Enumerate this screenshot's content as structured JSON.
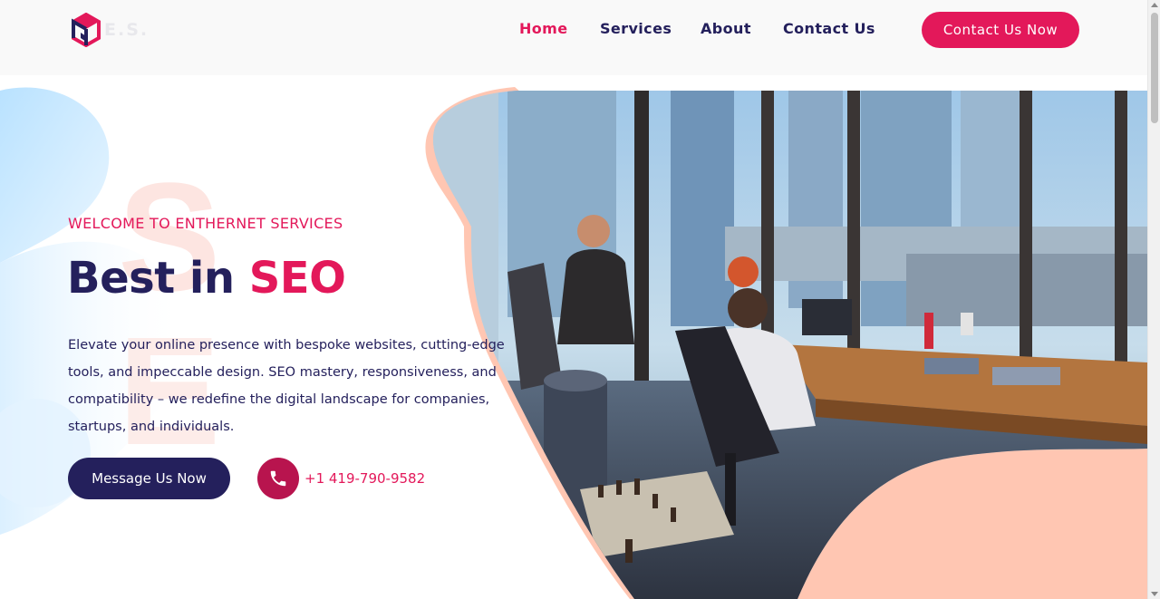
{
  "header": {
    "logo_text": "E.S.",
    "nav": [
      {
        "label": "Home",
        "active": true
      },
      {
        "label": "Services",
        "active": false
      },
      {
        "label": "About",
        "active": false
      },
      {
        "label": "Contact Us",
        "active": false
      }
    ],
    "cta_label": "Contact Us Now"
  },
  "hero": {
    "eyebrow": "WELCOME TO ENTHERNET SERVICES",
    "headline_part1": "Best in ",
    "headline_part2": "SEO",
    "description": "Elevate your online presence with bespoke websites, cutting-edge tools, and impeccable design. SEO mastery, responsiveness, and compatibility – we redefine the digital landscape for companies, startups, and individuals.",
    "message_button": "Message Us Now",
    "phone": "+1 419-790-9582",
    "phone_icon": "phone-icon",
    "image_icon": "office-photo"
  },
  "colors": {
    "primary": "#24205c",
    "accent": "#e3185a",
    "peach": "#ffc6b2",
    "light_blue": "#cfeaff"
  }
}
